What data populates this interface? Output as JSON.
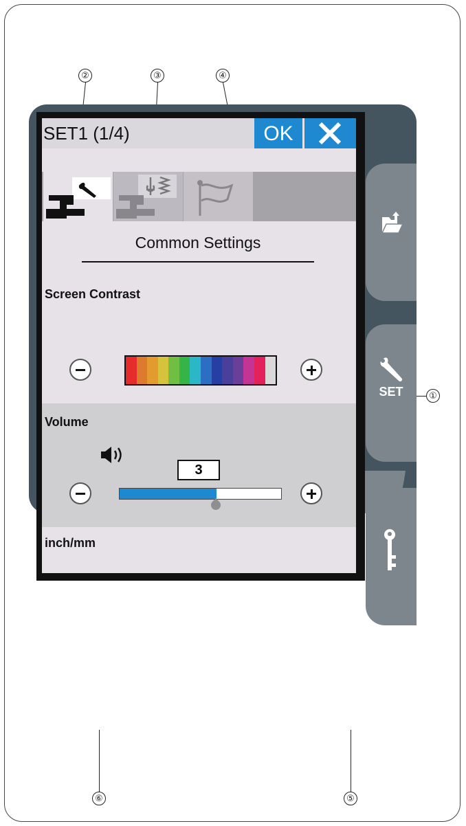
{
  "callouts": [
    "①",
    "②",
    "③",
    "④",
    "⑤",
    "⑥"
  ],
  "header": {
    "title": "SET1 (1/4)",
    "ok_label": "OK",
    "close_icon": "close-icon"
  },
  "tabs": [
    {
      "icon": "wrench-machine-icon",
      "selected": true
    },
    {
      "icon": "stitch-machine-icon",
      "selected": false
    },
    {
      "icon": "flag-icon",
      "selected": false
    }
  ],
  "section_title": "Common Settings",
  "screen_contrast": {
    "label": "Screen Contrast",
    "colors": [
      "#e52b2b",
      "#dd7a2e",
      "#e39b2f",
      "#d5c43b",
      "#70bf43",
      "#35b548",
      "#2bb7c8",
      "#2c6fc2",
      "#253fa4",
      "#4b3f9c",
      "#6b3e99",
      "#c43495",
      "#e3215c",
      "#d9d9d9"
    ]
  },
  "volume": {
    "label": "Volume",
    "value": "3",
    "level_fraction": 0.6,
    "speaker_icon": "speaker-icon"
  },
  "units": {
    "label": "inch/mm",
    "inch_label": "inch",
    "mm_label": "mm",
    "selected": "mm"
  },
  "side_buttons": [
    {
      "icon": "folder-upload-icon"
    },
    {
      "icon": "wrench-icon",
      "label": "SET"
    },
    {
      "icon": "key-icon"
    }
  ],
  "bottom": {
    "prev_icon": "left-triangle-icon",
    "next_icon": "right-triangle-icon",
    "scroll_icon": "scroll-bars-icon"
  },
  "colors": {
    "accent": "#1e88d0",
    "device": "#445560",
    "panel": "#7d868d"
  }
}
